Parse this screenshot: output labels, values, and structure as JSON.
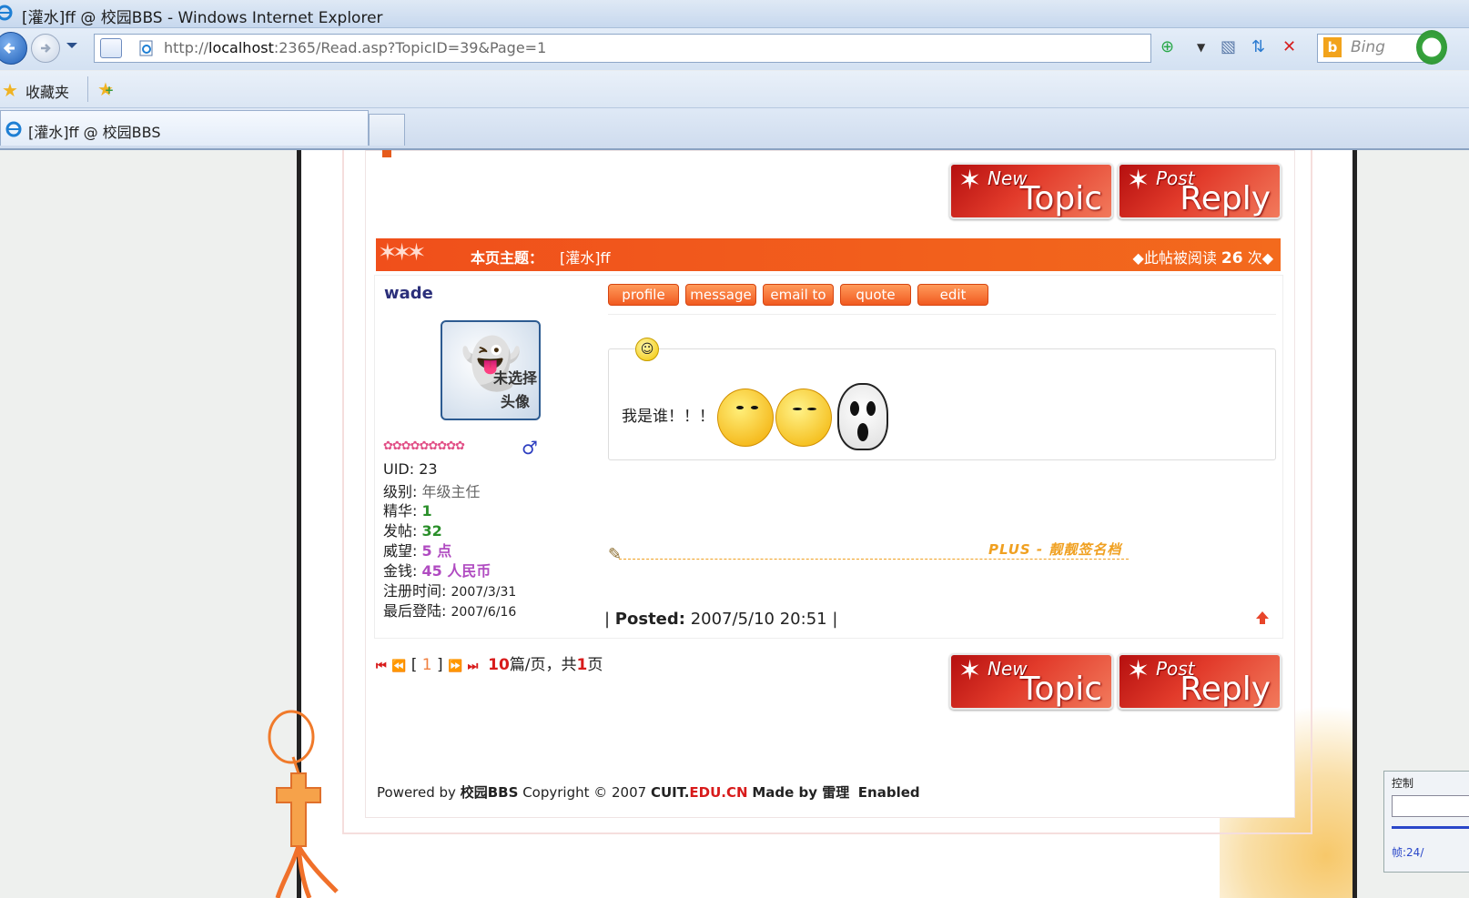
{
  "browser": {
    "window_title": "[灌水]ff @ 校园BBS - Windows Internet Explorer",
    "url_prefix": "http://",
    "url_host": "localhost",
    "url_rest": ":2365/Read.asp?TopicID=39&Page=1",
    "search_placeholder": "Bing",
    "favorites_label": "收藏夹",
    "tab_title": "[灌水]ff @ 校园BBS"
  },
  "buttons": {
    "new_topic_small": "New",
    "new_topic_big": "Topic",
    "post_reply_small": "Post",
    "post_reply_big": "Reply"
  },
  "topic_bar": {
    "label": "本页主题：",
    "subject": "[灌水]ff",
    "reads_prefix": "◆此帖被阅读",
    "reads_count": "26",
    "reads_suffix": "次◆"
  },
  "post": {
    "username": "wade",
    "avatar_text_1": "未选择",
    "avatar_text_2": "头像",
    "rank_stars": "✿✿✿✿✿✿✿✿✿",
    "gender_symbol": "♂",
    "stats": {
      "uid_label": "UID:",
      "uid": "23",
      "level_label": "级别:",
      "level": "年级主任",
      "elite_label": "精华:",
      "elite": "1",
      "posts_label": "发帖:",
      "posts": "32",
      "prestige_label": "威望:",
      "prestige": "5 点",
      "money_label": "金钱:",
      "money": "45 人民币",
      "register_label": "注册时间:",
      "register": "2007/3/31",
      "lastlogin_label": "最后登陆:",
      "lastlogin": "2007/6/16"
    },
    "actions": [
      "profile",
      "message",
      "email to",
      "quote",
      "edit"
    ],
    "message_text": "我是谁！！！",
    "signature": "PLUS - 靓靓签名档",
    "posted_label": "Posted:",
    "posted_time": "2007/5/10 20:51"
  },
  "pager": {
    "current_page": "1",
    "per_page": "10",
    "per_page_suffix": "篇/页，共",
    "total_pages": "1",
    "total_suffix": "页"
  },
  "footer": {
    "powered_by": "Powered by",
    "brand": "校园BBS",
    "copyright": "Copyright © 2007",
    "site_a": "CUIT.",
    "site_b": "EDU.CN",
    "made_by": "Made by 雷理",
    "enabled": "Enabled"
  },
  "side_panel": {
    "label": "控制",
    "frame": "帧:24/"
  },
  "colors": {
    "accent_orange": "#f36a1d",
    "button_red": "#e23b2b",
    "username_blue": "#2b2f7a",
    "stat_green": "#2a8f2a",
    "stat_purple": "#b04bc1"
  }
}
